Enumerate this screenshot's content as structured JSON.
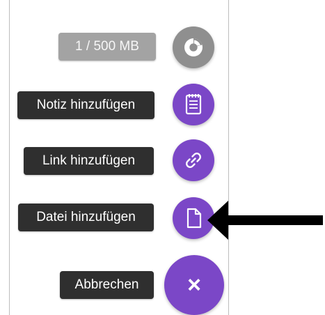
{
  "speed_dial": {
    "storage_label": "1 / 500 MB",
    "note_label": "Notiz hinzufügen",
    "link_label": "Link hinzufügen",
    "file_label": "Datei hinzufügen",
    "cancel_label": "Abbrechen",
    "close_glyph": "×"
  },
  "icons": {
    "storage": "pie-chart-icon",
    "note": "notepad-icon",
    "link": "link-icon",
    "file": "file-icon",
    "close": "close-icon",
    "pointer": "arrow-left-icon"
  },
  "colors": {
    "accent": "#7b47c7",
    "storage_button": "#8f8f8f",
    "storage_label_bg": "#a3a3a3",
    "label_bg": "#2f2f2f",
    "arrow": "#000000"
  }
}
